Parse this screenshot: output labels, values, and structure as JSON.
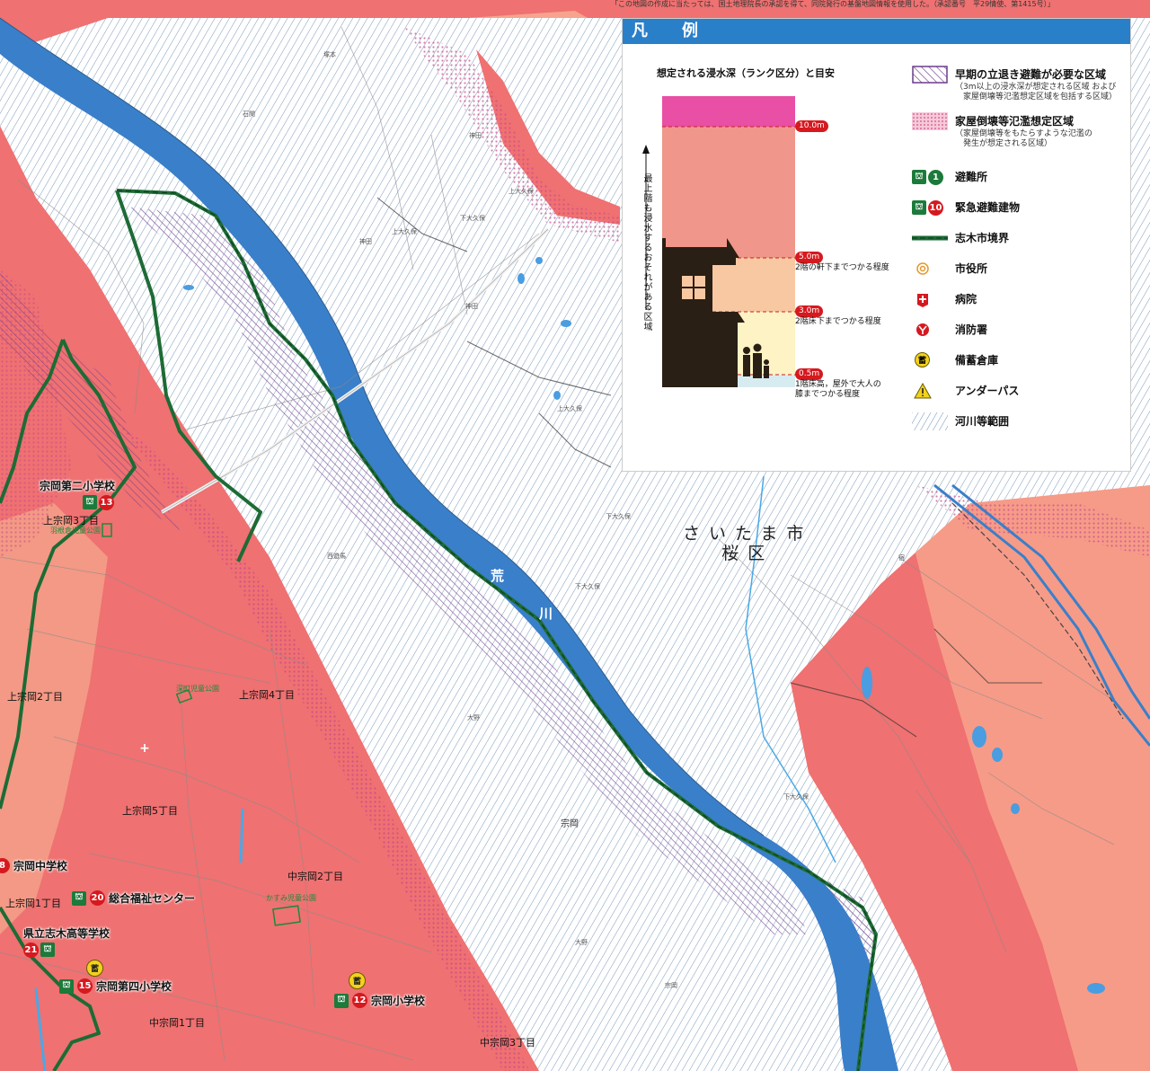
{
  "credit": "「この地図の作成に当たっては、国土地理院長の承認を得て、同院発行の基盤地図情報を使用した。（承認番号　平29情使、第1415号）」",
  "colors": {
    "flood_high": "#ec6a6a",
    "flood_mid": "#f39d87",
    "river_blue": "#3a7fc9",
    "river_area_hatch": "#6a8fb3",
    "boundary_green": "#1d6b35",
    "legend_header": "#2a7fc9",
    "rank_10m": "#e84fa5",
    "rank_5_10": "#f0968a",
    "rank_3_5": "#f7c8a2",
    "rank_05_3": "#fdf3c4",
    "rank_0_05": "#d7ecf0"
  },
  "legend": {
    "title": "凡　例",
    "depth_title": "想定される浸水深（ランク区分）と目安",
    "axis_note": "最上階も浸水するおそれがある区域",
    "levels": [
      {
        "tag": "10.0m",
        "desc": ""
      },
      {
        "tag": "5.0m",
        "desc": "2階の軒下までつかる程度"
      },
      {
        "tag": "3.0m",
        "desc": "2階床下までつかる程度"
      },
      {
        "tag": "0.5m",
        "desc": "1階床高，屋外で大人の\n膝までつかる程度"
      }
    ],
    "items": [
      {
        "icon": "evacuation-area-hatch-icon",
        "label": "早期の立退き避難が必要な区域",
        "note": "（3m以上の浸水深が想定される区域 および\n　家屋倒壊等氾濫想定区域を包括する区域）"
      },
      {
        "icon": "collapse-zone-dots-icon",
        "label": "家屋倒壊等氾濫想定区域",
        "note": "（家屋倒壊等をもたらすような氾濫の\n　発生が想定される区域）"
      },
      {
        "icon": "shelter-icon",
        "num": "1",
        "label": "避難所"
      },
      {
        "icon": "emergency-building-icon",
        "num": "10",
        "label": "緊急避難建物"
      },
      {
        "icon": "city-boundary-line-icon",
        "label": "志木市境界"
      },
      {
        "icon": "city-hall-icon",
        "label": "市役所"
      },
      {
        "icon": "hospital-icon",
        "label": "病院"
      },
      {
        "icon": "fire-station-icon",
        "label": "消防署"
      },
      {
        "icon": "storehouse-icon",
        "glyph": "蓄",
        "label": "備蓄倉庫"
      },
      {
        "icon": "underpass-warning-icon",
        "label": "アンダーパス"
      },
      {
        "icon": "river-area-hatch-icon",
        "label": "河川等範囲"
      }
    ]
  },
  "map": {
    "city_label": "さいたま市\n桜区",
    "river_name": [
      "荒",
      "川"
    ],
    "facilities": [
      {
        "name": "宗岡第二小学校",
        "num": "13",
        "type": "emergency"
      },
      {
        "name": "宗岡中学校",
        "num": "8",
        "type": "emergency"
      },
      {
        "name": "総合福祉センター",
        "num": "20",
        "type": "emergency"
      },
      {
        "name": "県立志木高等学校",
        "num": "21",
        "type": "emergency"
      },
      {
        "name": "宗岡第四小学校",
        "num": "15",
        "type": "emergency"
      },
      {
        "name": "宗岡小学校",
        "num": "12",
        "type": "emergency"
      }
    ],
    "store_glyph": "蓄",
    "hospital_glyph": "+",
    "districts": {
      "kamimuneoka3": "上宗岡3丁目",
      "kamimuneoka2": "上宗岡2丁目",
      "kamimuneoka4": "上宗岡4丁目",
      "kamimuneoka5": "上宗岡5丁目",
      "kamimuneoka1": "上宗岡1丁目",
      "nakamuneoka2": "中宗岡2丁目",
      "nakamuneoka1": "中宗岡1丁目",
      "nakamuneoka3": "中宗岡3丁目",
      "muneoka": "宗岡"
    },
    "parks": {
      "hanenkura": "羽根倉児童公園",
      "fukamachi": "深町児童公園",
      "kasumi": "かすみ児童公園"
    },
    "places": {
      "kamiookubo1": "上大久保",
      "kamiookubo2": "上大久保",
      "shimoookubo1": "下大久保",
      "shimoookubo2": "下大久保",
      "shimoookubo3": "下大久保",
      "kanda1": "神田",
      "kanda2": "神田",
      "kanda3": "神田",
      "ishibashi": "石関",
      "sakuramoto": "塚本",
      "kubo": "西遊馬",
      "murota": "大野",
      "oono": "大野",
      "shimonoya": "下大久保",
      "harumi": "上大久保",
      "koda": "宿",
      "naka": "宗岡"
    }
  }
}
